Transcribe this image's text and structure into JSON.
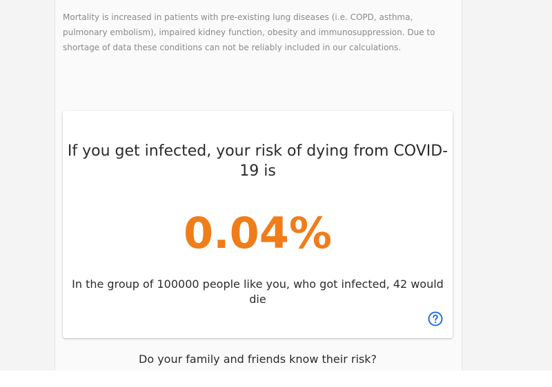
{
  "note": {
    "text": "Mortality is increased in patients with pre-existing lung diseases (i.e. COPD, asthma, pulmonary embolism), impaired kidney function, obesity and immunosuppression. Due to shortage of data these conditions can not be reliably included in our calculations."
  },
  "result_card": {
    "heading": "If you get infected, your risk of dying from COVID-19 is",
    "risk_value": "0.04%",
    "detail": "In the group of 100000 people like you, who got infected, 42 would die",
    "help_icon": "help-circle-icon"
  },
  "footer": {
    "question": "Do your family and friends know their risk?"
  },
  "colors": {
    "accent": "#f07d1a",
    "help_icon": "#1e6fe0",
    "text": "#2b2b2b",
    "muted": "#8a8a8a"
  }
}
